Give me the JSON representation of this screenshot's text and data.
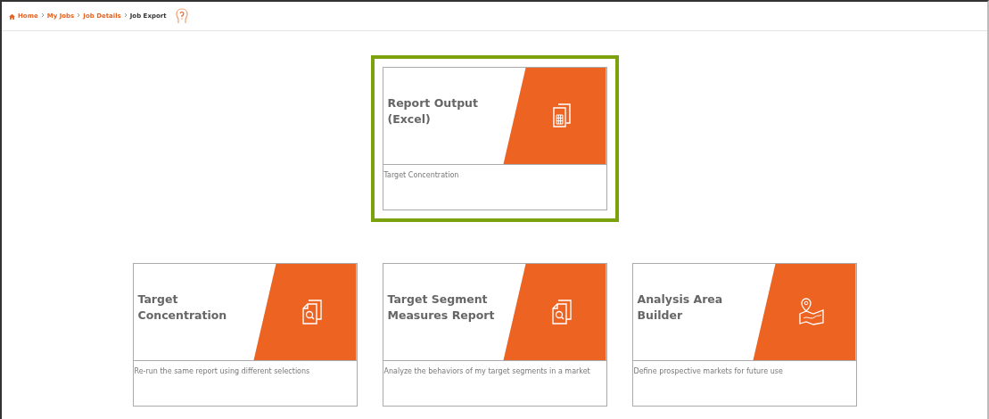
{
  "breadcrumb": [
    {
      "label": "Home",
      "current": false
    },
    {
      "label": "My Jobs",
      "current": false
    },
    {
      "label": "Job Details",
      "current": false
    },
    {
      "label": "Job Export",
      "current": true
    }
  ],
  "rows": [
    {
      "cards": [
        {
          "title": "Report Output (Excel)",
          "description": "Target Concentration",
          "kind": "spreadsheet",
          "selected": true
        }
      ]
    },
    {
      "cards": [
        {
          "title": "Target Concentration",
          "description": "Re-run the same report using different selections",
          "kind": "document-search",
          "selected": false
        },
        {
          "title": "Target Segment Measures Report",
          "description": "Analyze the behaviors of my target segments in a market",
          "kind": "document-search",
          "selected": false
        },
        {
          "title": "Analysis Area Builder",
          "description": "Define prospective markets for future use",
          "kind": "map-pin",
          "selected": false
        }
      ]
    }
  ]
}
